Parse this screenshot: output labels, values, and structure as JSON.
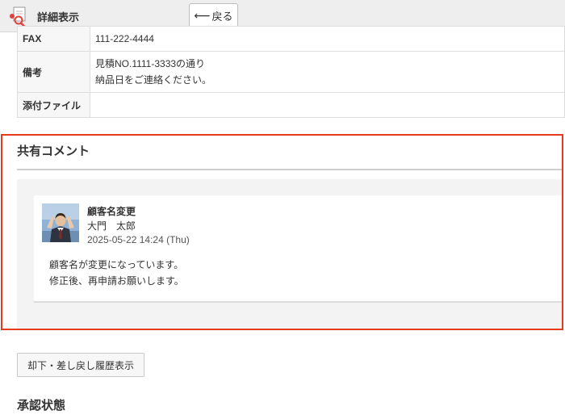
{
  "header": {
    "title": "詳細表示",
    "back_label": "戻る"
  },
  "info_table": {
    "rows": [
      {
        "label": "FAX",
        "value_lines": [
          "111-222-4444"
        ]
      },
      {
        "label": "備考",
        "value_lines": [
          "見積NO.1111-3333の通り",
          "納品日をご連絡ください。"
        ]
      },
      {
        "label": "添付ファイル",
        "value_lines": []
      }
    ]
  },
  "shared_comments": {
    "title": "共有コメント",
    "comments": [
      {
        "subject": "顧客名変更",
        "author": "大門　太郎",
        "datetime": "2025-05-22 14:24 (Thu)",
        "body_lines": [
          "顧客名が変更になっています。",
          "修正後、再申請お願いします。"
        ]
      }
    ]
  },
  "history_button_label": "却下・差し戻し履歴表示",
  "approval_status": {
    "title": "承認状態"
  },
  "colors": {
    "highlight_border": "#e63a1e",
    "header_bg": "#eeeeee",
    "comment_area_bg": "#f3f3f3"
  }
}
